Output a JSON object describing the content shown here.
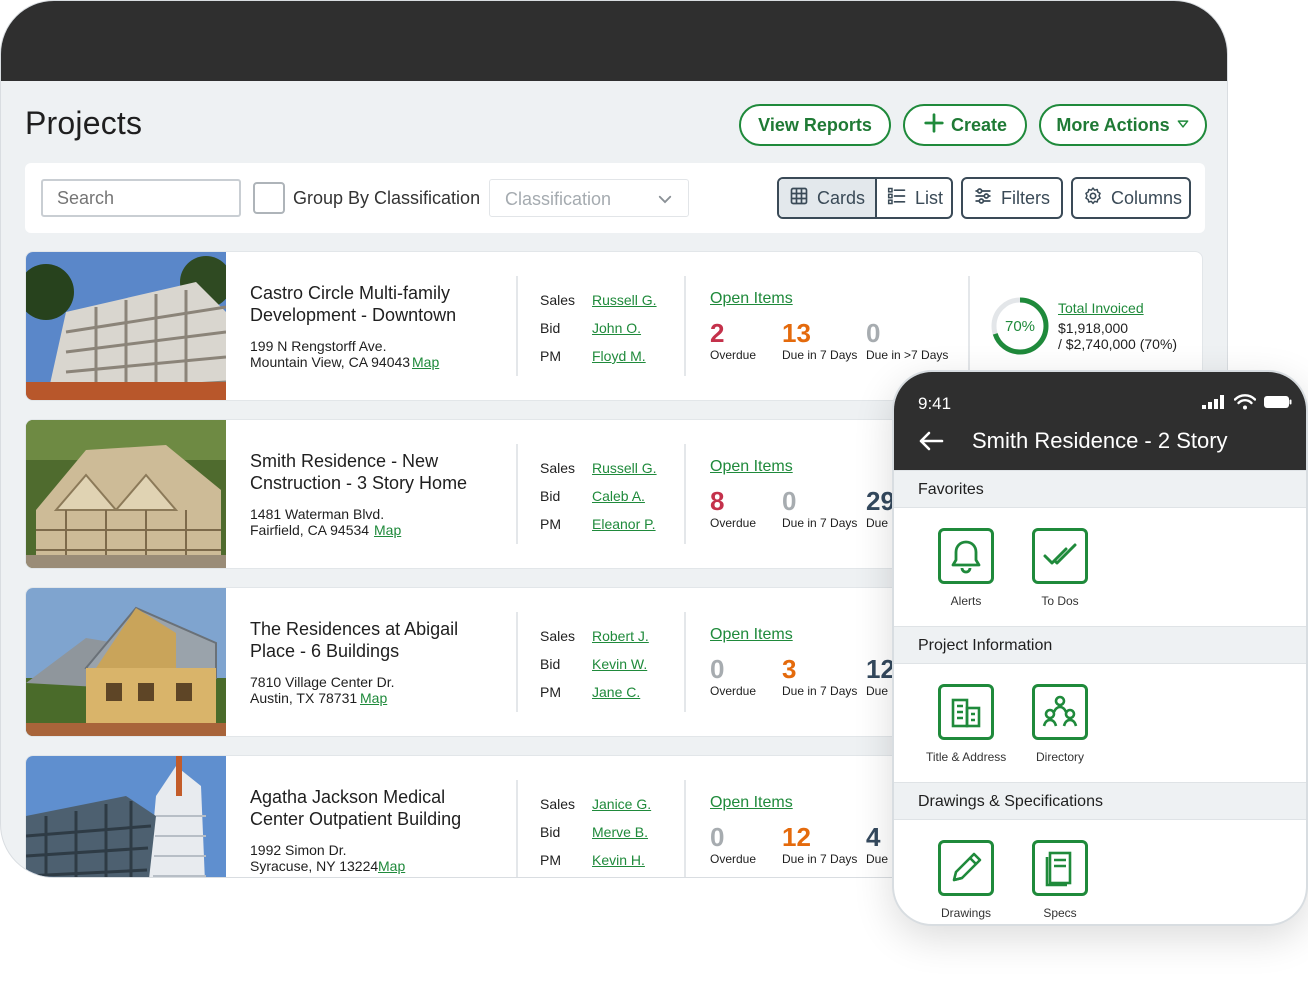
{
  "page": {
    "title": "Projects"
  },
  "header_buttons": {
    "view_reports": "View Reports",
    "create": "Create",
    "more_actions": "More Actions"
  },
  "toolbar": {
    "search_placeholder": "Search",
    "group_by_label": "Group By Classification",
    "classification_placeholder": "Classification",
    "cards_label": "Cards",
    "list_label": "List",
    "filters_label": "Filters",
    "columns_label": "Columns"
  },
  "colors": {
    "brand_green": "#1f8a3b",
    "overdue_red": "#c4314b",
    "due_orange": "#e46a0c",
    "zero_gray": "#a7acb0",
    "slate": "#34495e",
    "chrome_dark": "#2f2f2f"
  },
  "roles": {
    "sales": "Sales",
    "bid": "Bid",
    "pm": "PM"
  },
  "labels": {
    "open_items": "Open Items",
    "overdue": "Overdue",
    "due_7": "Due in 7 Days",
    "due_gt7": "Due in >7 Days",
    "due_short": "Due",
    "map": "Map"
  },
  "projects": [
    {
      "name": "Castro Circle Multi-family Development - Downtown",
      "address_line1": "199 N Rengstorff Ave.",
      "address_line2": "Mountain View, CA 94043",
      "sales": "Russell G.",
      "bid": "John O.",
      "pm": "Floyd M.",
      "overdue": "2",
      "due_7": "13",
      "due_gt7": "0",
      "invoice": {
        "percent": 70,
        "percent_label": "70%",
        "title": "Total Invoiced",
        "amount": "$1,918,000",
        "total": "/ $2,740,000 (70%)"
      }
    },
    {
      "name": "Smith Residence - New Cnstruction - 3 Story Home",
      "address_line1": "1481 Waterman Blvd.",
      "address_line2": "Fairfield, CA 94534",
      "sales": "Russell G.",
      "bid": "Caleb A.",
      "pm": "Eleanor P.",
      "overdue": "8",
      "due_7": "0",
      "due_gt7": "29"
    },
    {
      "name": "The Residences at Abigail Place - 6 Buildings",
      "address_line1": "7810 Village Center Dr.",
      "address_line2": "Austin, TX 78731",
      "sales": "Robert J.",
      "bid": "Kevin W.",
      "pm": "Jane C.",
      "overdue": "0",
      "due_7": "3",
      "due_gt7": "12"
    },
    {
      "name": "Agatha Jackson Medical Center Outpatient Building",
      "address_line1": "1992 Simon Dr.",
      "address_line2": "Syracuse, NY 13224",
      "sales": "Janice G.",
      "bid": "Merve B.",
      "pm": "Kevin H.",
      "overdue": "0",
      "due_7": "12",
      "due_gt7": "4"
    }
  ],
  "mobile": {
    "time": "9:41",
    "title": "Smith Residence - 2 Story",
    "sections": [
      {
        "title": "Favorites",
        "tiles": [
          {
            "label": "Alerts",
            "icon": "bell-icon"
          },
          {
            "label": "To Dos",
            "icon": "checkmarks-icon"
          }
        ]
      },
      {
        "title": "Project Information",
        "tiles": [
          {
            "label": "Title & Address",
            "icon": "buildings-icon"
          },
          {
            "label": "Directory",
            "icon": "people-icon"
          }
        ]
      },
      {
        "title": "Drawings & Specifications",
        "tiles": [
          {
            "label": "Drawings",
            "icon": "pencil-icon"
          },
          {
            "label": "Specs",
            "icon": "document-icon"
          }
        ]
      }
    ]
  }
}
